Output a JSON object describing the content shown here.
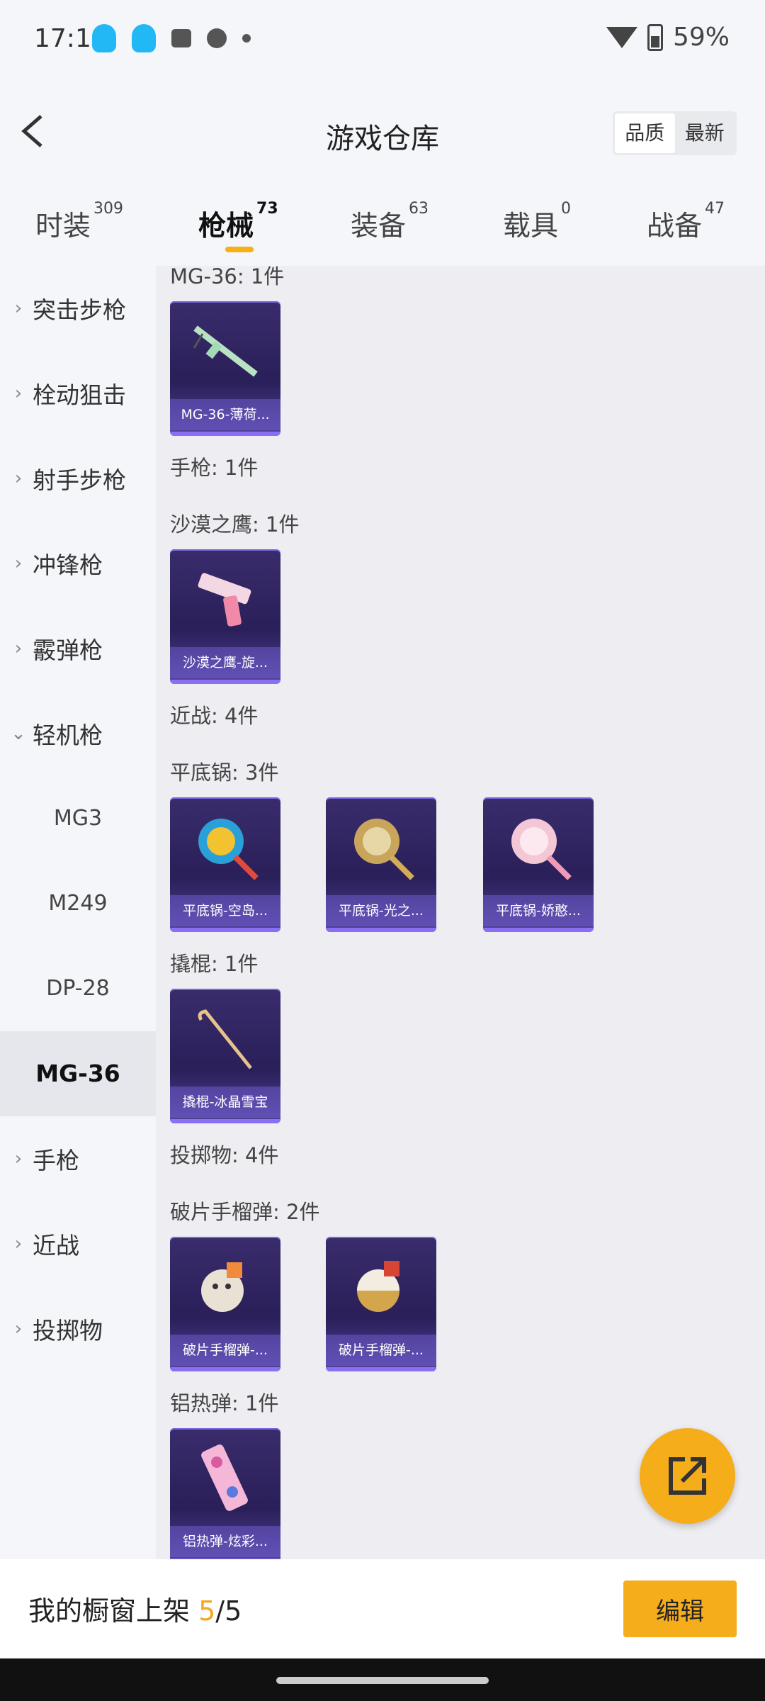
{
  "status_bar": {
    "time": "17:16",
    "battery": "59%"
  },
  "header": {
    "title": "游戏仓库",
    "sort_options": [
      "品质",
      "最新"
    ]
  },
  "tabs": [
    {
      "label": "时装",
      "count": "309"
    },
    {
      "label": "枪械",
      "count": "73"
    },
    {
      "label": "装备",
      "count": "63"
    },
    {
      "label": "载具",
      "count": "0"
    },
    {
      "label": "战备",
      "count": "47"
    }
  ],
  "sidebar": {
    "items": [
      "突击步枪",
      "栓动狙击",
      "射手步枪",
      "冲锋枪",
      "霰弹枪",
      "轻机枪",
      "手枪",
      "近战",
      "投掷物"
    ],
    "sub_items": [
      "MG3",
      "M249",
      "DP-28",
      "MG-36"
    ]
  },
  "content": {
    "labels": [
      "MG-36: 1件",
      "手枪: 1件",
      "沙漠之鹰: 1件",
      "近战: 4件",
      "平底锅: 3件",
      "撬棍: 1件",
      "投掷物: 4件",
      "破片手榴弹: 2件",
      "铝热弹: 1件"
    ],
    "cards": [
      "MG-36-薄荷...",
      "沙漠之鹰-旋...",
      "平底锅-空岛...",
      "平底锅-光之...",
      "平底锅-娇憨...",
      "撬棍-冰晶雪宝",
      "破片手榴弹-...",
      "破片手榴弹-...",
      "铝热弹-炫彩..."
    ]
  },
  "bottom": {
    "prefix": "我的橱窗上架 ",
    "count": "5",
    "suffix": "/5",
    "edit_label": "编辑"
  },
  "colors": {
    "accent": "#f5ad1a",
    "card_bg": "#2a1f59"
  }
}
